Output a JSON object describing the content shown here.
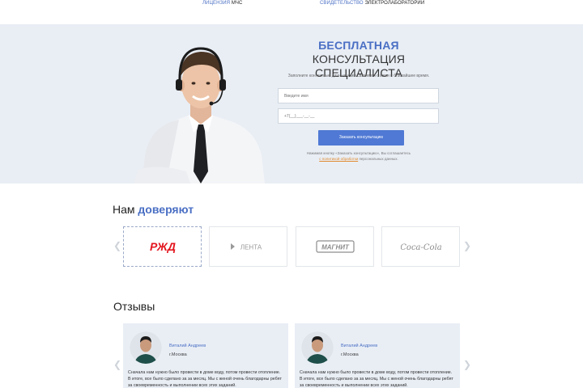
{
  "top_links": [
    {
      "highlight": "ЛИЦЕНЗИЯ",
      "rest": " МЧС"
    },
    {
      "highlight": "СВИДЕТЕЛЬСТВО",
      "rest": " ЭЛЕКТРОЛАБОРАТОРИИ"
    }
  ],
  "consult": {
    "title_accent": "БЕСПЛАТНАЯ",
    "title_rest": " КОНСУЛЬТАЦИЯ",
    "title_line2": "СПЕЦИАЛИСТА",
    "subtitle": "Заполните контактные данные и мы свяжемся с вами в ближайшее время.",
    "name_placeholder": "Введите имя",
    "phone_placeholder": "+7(__)___-__-__",
    "button": "Заказать консультацию",
    "consent_before": "Нажимая кнопку «Заказать консультацию», Вы соглашаетесь",
    "consent_link": "с политикой обработки",
    "consent_after": " персональных данных."
  },
  "trust": {
    "title_plain": "Нам ",
    "title_accent": "доверяют",
    "logos": [
      {
        "name": "РЖД",
        "icon": "rzd-logo"
      },
      {
        "name": "ЛЕНТА",
        "icon": "lenta-logo"
      },
      {
        "name": "МАГНИТ",
        "icon": "magnit-logo"
      },
      {
        "name": "Coca-Cola",
        "icon": "coca-cola-logo"
      }
    ],
    "prev_icon": "chevron-left-icon",
    "next_icon": "chevron-right-icon"
  },
  "reviews": {
    "title": "Отзывы",
    "items": [
      {
        "name": "Виталий Андреев",
        "city": "г.Москва",
        "text": "Сначала нам нужно было провести в доме воду, потом провести отопление. В итоге, все было сделано за за месяц. Мы с женой очень благодарны ребят за своевременность и выполнении всех этих заданий."
      },
      {
        "name": "Виталий Андреев",
        "city": "г.Москва",
        "text": "Сначала нам нужно было провести в доме воду, потом провести отопление. В итоге, все было сделано за за месяц. Мы с женой очень благодарны ребят за своевременность и выполнении всех этих заданий."
      }
    ]
  },
  "colors": {
    "accent": "#4a6fc4",
    "button": "#4f79d4",
    "band": "#e9eef5",
    "link_orange": "#e08a2e"
  }
}
